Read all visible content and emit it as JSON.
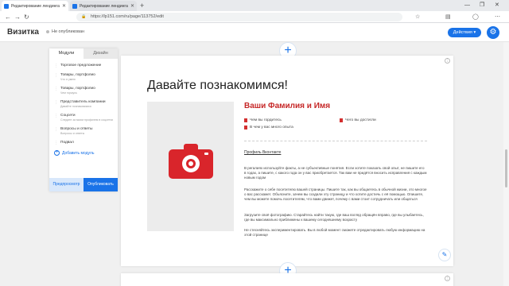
{
  "browser": {
    "tabs": [
      {
        "label": "Редактирование лендинга | [B"
      },
      {
        "label": "Редактирование лендинга | [B"
      }
    ],
    "new_tab_icon": "+",
    "url": "https://lp151.com/ru/page/113752/edit",
    "window_controls": [
      "—",
      "❐",
      "✕"
    ]
  },
  "app": {
    "title": "Визитка",
    "status": "Не опубликован",
    "actions_label": "Действия",
    "settings_icon": "gear-icon"
  },
  "sidebar": {
    "tabs": [
      {
        "label": "Модули",
        "active": true
      },
      {
        "label": "Дизайн",
        "active": false
      }
    ],
    "items": [
      {
        "title": "Торговое предложение",
        "subtitle": ""
      },
      {
        "title": "Товары, портфолио",
        "subtitle": "Что я умею"
      },
      {
        "title": "Товары, портфолио",
        "subtitle": "Чем горжусь"
      },
      {
        "title": "Представитель компании",
        "subtitle": "Давайте познакомимся"
      },
      {
        "title": "Соцсети",
        "subtitle": "Следите за моим профилем в соцсетях"
      },
      {
        "title": "Вопросы и ответы",
        "subtitle": "Вопросы и ответы"
      },
      {
        "title": "Подвал",
        "subtitle": ""
      }
    ],
    "add_module": "Добавить модуль",
    "preview_label": "Предпросмотр",
    "publish_label": "Опубликовать"
  },
  "card": {
    "heading": "Давайте познакомимся!",
    "name": "Ваши Фамилия и Имя",
    "bullets": [
      "Чем вы гордитесь",
      "Чего вы достигли",
      "В чем у вас много опыта"
    ],
    "link": "Профиль Вконтакте",
    "paragraphs": [
      "В регалиях используйте факты, а не субъективные понятия. Если хотите показать свой опыт, не пишите его в годах, а пишите, с какого года он у вас приобретается. Так вам не придётся вносить исправления с каждым новым годом",
      "Расскажите о себе посетителю вашей страницы. Пишите так, как вы общаетесь в обычной жизни, это многое о вас расскажет. Объясните, зачем вы создали эту страницу и что хотите достичь с её помощью. Опишите, чем вы можете помочь посетителям, что вами движет, почему с вами стоит сотрудничать или общаться",
      "Загрузите своё фотографию. Старайтесь найти такую, где ваш взгляд обращён вправо, где вы улыбаетесь, где вы максимально приближены к вашему сегодняшнему возрасту",
      "Не стесняйтесь экспериментировать. Вы в любой момент сможете отредактировать любую информацию на этой странице"
    ]
  },
  "colors": {
    "accent": "#1a73e8",
    "brand_red": "#c62828"
  }
}
